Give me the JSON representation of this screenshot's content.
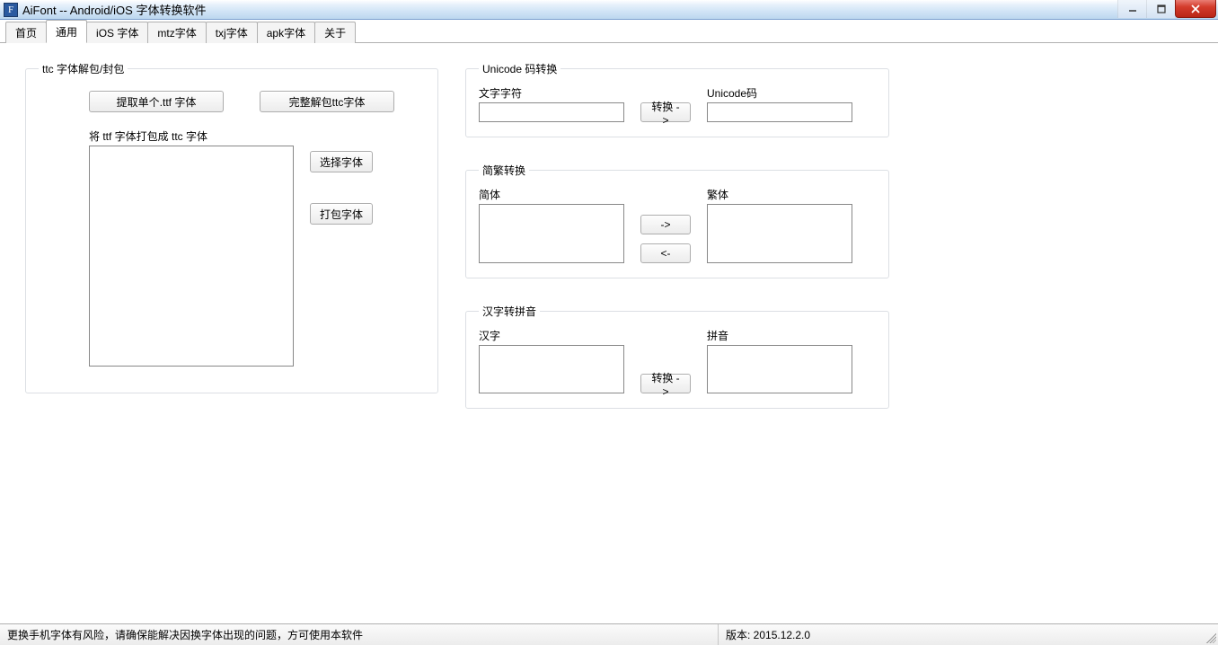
{
  "window": {
    "title": "AiFont -- Android/iOS 字体转换软件",
    "icon_letter": "F"
  },
  "tabs": {
    "items": [
      {
        "label": "首页"
      },
      {
        "label": "通用"
      },
      {
        "label": "iOS 字体"
      },
      {
        "label": "mtz字体"
      },
      {
        "label": "txj字体"
      },
      {
        "label": "apk字体"
      },
      {
        "label": "关于"
      }
    ],
    "active_index": 1
  },
  "ttc": {
    "legend": "ttc 字体解包/封包",
    "extract_single_btn": "提取单个.ttf 字体",
    "unpack_all_btn": "完整解包ttc字体",
    "pack_label": "将 ttf 字体打包成 ttc 字体",
    "select_font_btn": "选择字体",
    "pack_font_btn": "打包字体"
  },
  "unicode": {
    "legend": "Unicode 码转换",
    "char_label": "文字字符",
    "code_label": "Unicode码",
    "convert_btn": "转换 ->",
    "char_value": "",
    "code_value": ""
  },
  "jianfan": {
    "legend": "简繁转换",
    "simp_label": "简体",
    "trad_label": "繁体",
    "to_trad_btn": "->",
    "to_simp_btn": "<-",
    "simp_value": "",
    "trad_value": ""
  },
  "pinyin": {
    "legend": "汉字转拼音",
    "hanzi_label": "汉字",
    "pinyin_label": "拼音",
    "convert_btn": "转换 ->",
    "hanzi_value": "",
    "pinyin_value": ""
  },
  "status": {
    "message": "更换手机字体有风险，请确保能解决因换字体出现的问题，方可使用本软件",
    "version": "版本: 2015.12.2.0"
  }
}
